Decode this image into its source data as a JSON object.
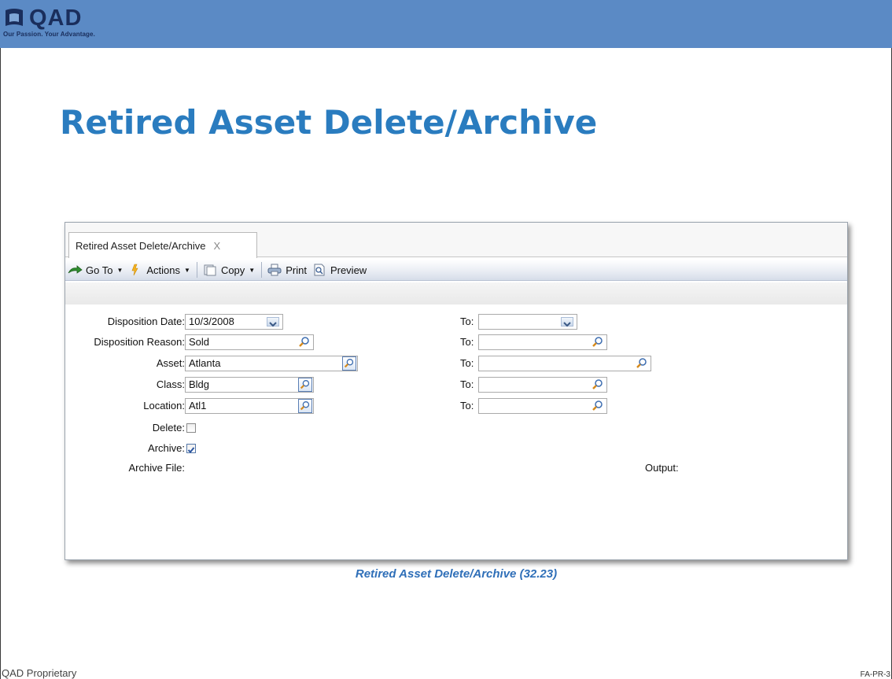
{
  "brand": {
    "logo_text": "QAD",
    "tagline": "Our Passion. Your Advantage."
  },
  "slide": {
    "title": "Retired Asset Delete/Archive",
    "caption": "Retired Asset Delete/Archive (32.23)",
    "footer_left": "QAD Proprietary",
    "footer_right": "FA-PR-3"
  },
  "window": {
    "tab_label": "Retired Asset Delete/Archive",
    "tab_close": "X",
    "toolbar": {
      "goto_label": "Go To",
      "actions_label": "Actions",
      "copy_label": "Copy",
      "print_label": "Print",
      "preview_label": "Preview"
    },
    "form": {
      "disposition_date": {
        "label": "Disposition Date:",
        "value": "10/3/2008",
        "to_label": "To:",
        "to_value": ""
      },
      "disposition_reason": {
        "label": "Disposition Reason:",
        "value": "Sold",
        "to_label": "To:",
        "to_value": ""
      },
      "asset": {
        "label": "Asset:",
        "value": "Atlanta",
        "to_label": "To:",
        "to_value": ""
      },
      "class": {
        "label": "Class:",
        "value": "Bldg",
        "to_label": "To:",
        "to_value": ""
      },
      "location": {
        "label": "Location:",
        "value": "Atl1",
        "to_label": "To:",
        "to_value": ""
      },
      "delete": {
        "label": "Delete:",
        "checked": false
      },
      "archive": {
        "label": "Archive:",
        "checked": true
      },
      "archive_file": {
        "label": "Archive File:"
      },
      "output": {
        "label": "Output:"
      }
    }
  },
  "colors": {
    "top_bar": "#5b8ac5",
    "title": "#2a7cbf",
    "caption": "#2f6fb8"
  }
}
